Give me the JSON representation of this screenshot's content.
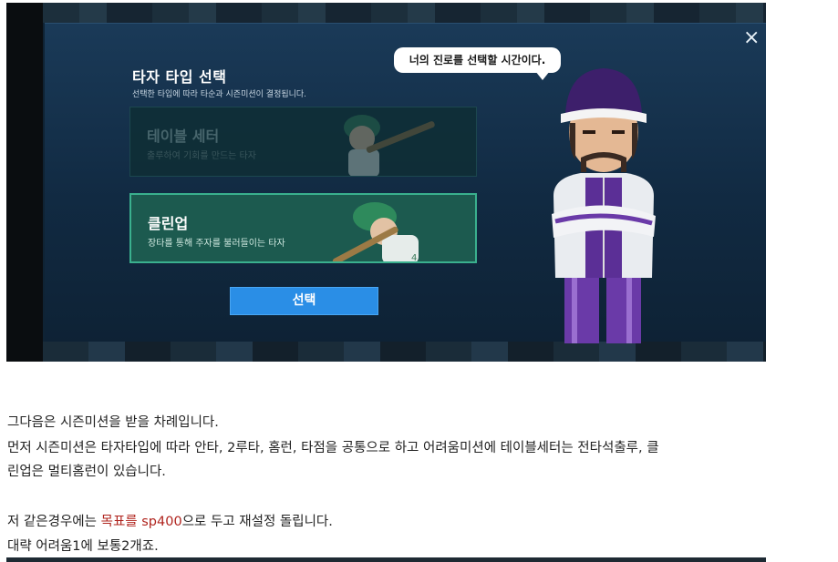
{
  "game": {
    "title": "타자 타입 선택",
    "subtitle": "선택한 타입에 따라 타순과 시즌미션이 결정됩니다.",
    "close_label": "×",
    "options": [
      {
        "label": "테이블 세터",
        "desc": "출루하여 기회를 만드는 타자",
        "selected": false
      },
      {
        "label": "클린업",
        "desc": "장타를 통해 주자를 불러들이는 타자",
        "selected": true
      }
    ],
    "select_button": "선택",
    "speech_bubble": "너의 진로를 선택할 시간이다.",
    "colors": {
      "selected_border": "#3ab08e",
      "button": "#2a8ee6",
      "modal_bg": "#112a42"
    }
  },
  "post": {
    "line1": "그다음은 시즌미션을 받을 차례입니다.",
    "line2": "먼저 시즌미션은 타자타입에 따라 안타, 2루타, 홈런, 타점을 공통으로 하고 어려움미션에 테이블세터는 전타석출루, 클",
    "line3": "린업은 멀티홈런이 있습니다.",
    "line4_pre": "저 같은경우에는 ",
    "line4_highlight": "목표를 sp400",
    "line4_post": "으로 두고 재설정 돌립니다.",
    "line5": "대략 어려움1에 보통2개죠.",
    "highlight_color": "#b0241e"
  }
}
